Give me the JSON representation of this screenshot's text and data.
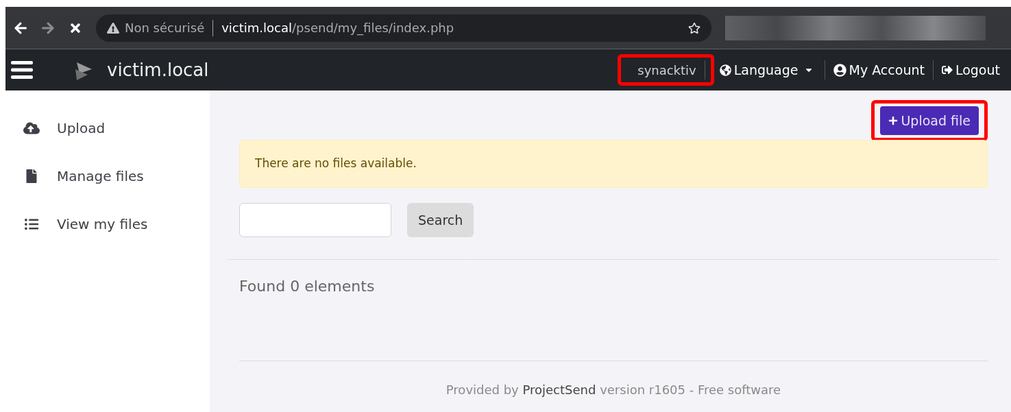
{
  "browser": {
    "back_enabled": true,
    "forward_enabled": false,
    "security_label": "Non sécurisé",
    "url_host": "victim.local",
    "url_path": "/psend/my_files/index.php"
  },
  "navbar": {
    "title": "victim.local",
    "user": {
      "label": "synacktiv",
      "highlighted": true
    },
    "language": "Language",
    "account": "My Account",
    "logout": "Logout"
  },
  "sidebar": {
    "items": [
      {
        "kind": "upload",
        "label": "Upload"
      },
      {
        "kind": "file",
        "label": "Manage files"
      },
      {
        "kind": "list",
        "label": "View my files"
      }
    ]
  },
  "upload_button": {
    "label": "Upload file",
    "highlighted": true
  },
  "alert": "There are no files available.",
  "search": {
    "button": "Search"
  },
  "result_count": "Found 0 elements",
  "footer": {
    "before": "Provided by ",
    "link": "ProjectSend",
    "after": " version r1605 - Free software"
  }
}
